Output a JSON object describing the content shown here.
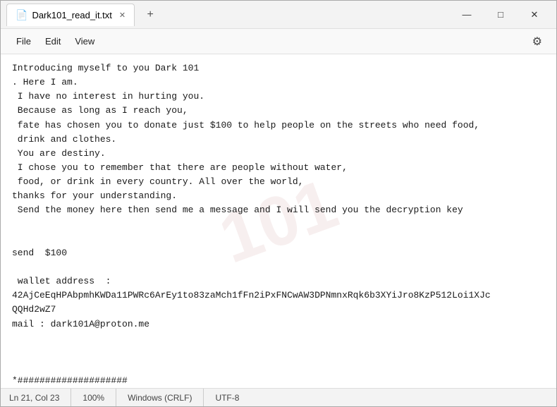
{
  "window": {
    "title": "Dark101_read_it.txt",
    "tab_icon": "📄"
  },
  "menu": {
    "items": [
      "File",
      "Edit",
      "View"
    ],
    "settings_icon": "⚙"
  },
  "content": {
    "text": "Introducing myself to you Dark 101\n. Here I am.\n I have no interest in hurting you.\n Because as long as I reach you,\n fate has chosen you to donate just $100 to help people on the streets who need food,\n drink and clothes.\n You are destiny.\n I chose you to remember that there are people without water,\n food, or drink in every country. All over the world,\nthanks for your understanding.\n Send the money here then send me a message and I will send you the decryption key\n\n\nsend  $100\n\n wallet address  :\n42AjCeEqHPAbpmhKWDa11PWRc6ArEy1to83zaMch1fFn2iPxFNCwAW3DPNmnxRqk6b3XYiJro8KzP512Loi1XJc\nQQHd2wZ7\nmail : dark101A@proton.me\n\n\n\n*####################"
  },
  "watermark": {
    "text": "101"
  },
  "status_bar": {
    "position": "Ln 21, Col 23",
    "zoom": "100%",
    "line_ending": "Windows (CRLF)",
    "encoding": "UTF-8"
  },
  "controls": {
    "minimize": "—",
    "maximize": "□",
    "close": "✕",
    "add_tab": "+"
  }
}
